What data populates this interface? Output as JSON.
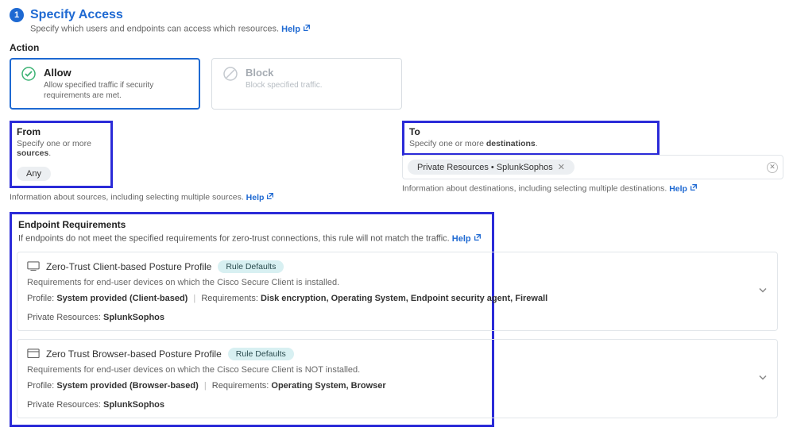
{
  "step": {
    "number": "1",
    "title": "Specify Access",
    "desc": "Specify which users and endpoints can access which resources.",
    "help": "Help"
  },
  "action": {
    "label": "Action",
    "allow": {
      "title": "Allow",
      "sub": "Allow specified traffic if security requirements are met."
    },
    "block": {
      "title": "Block",
      "sub": "Block specified traffic."
    }
  },
  "from": {
    "title": "From",
    "sub_pre": "Specify one or more ",
    "sub_bold": "sources",
    "sub_post": ".",
    "chip": "Any",
    "info": "Information about sources, including selecting multiple sources.",
    "help": "Help"
  },
  "to": {
    "title": "To",
    "sub_pre": "Specify one or more ",
    "sub_bold": "destinations",
    "sub_post": ".",
    "chip": "Private Resources • SplunkSophos",
    "info": "Information about destinations, including selecting multiple destinations.",
    "help": "Help"
  },
  "ep": {
    "title": "Endpoint Requirements",
    "desc": "If endpoints do not meet the specified requirements for zero-trust connections, this rule will not match the traffic.",
    "help": "Help"
  },
  "profiles": [
    {
      "name": "Zero-Trust Client-based Posture Profile",
      "badge": "Rule Defaults",
      "sub": "Requirements for end-user devices on which the Cisco Secure Client is installed.",
      "profile_label": "Profile:",
      "profile_value": "System provided (Client-based)",
      "req_label": "Requirements:",
      "req_value": "Disk encryption, Operating System, Endpoint security agent, Firewall",
      "pr_label": "Private Resources:",
      "pr_value": "SplunkSophos"
    },
    {
      "name": "Zero Trust Browser-based Posture Profile",
      "badge": "Rule Defaults",
      "sub": "Requirements for end-user devices on which the Cisco Secure Client is NOT installed.",
      "profile_label": "Profile:",
      "profile_value": "System provided (Browser-based)",
      "req_label": "Requirements:",
      "req_value": "Operating System, Browser",
      "pr_label": "Private Resources:",
      "pr_value": "SplunkSophos"
    }
  ]
}
